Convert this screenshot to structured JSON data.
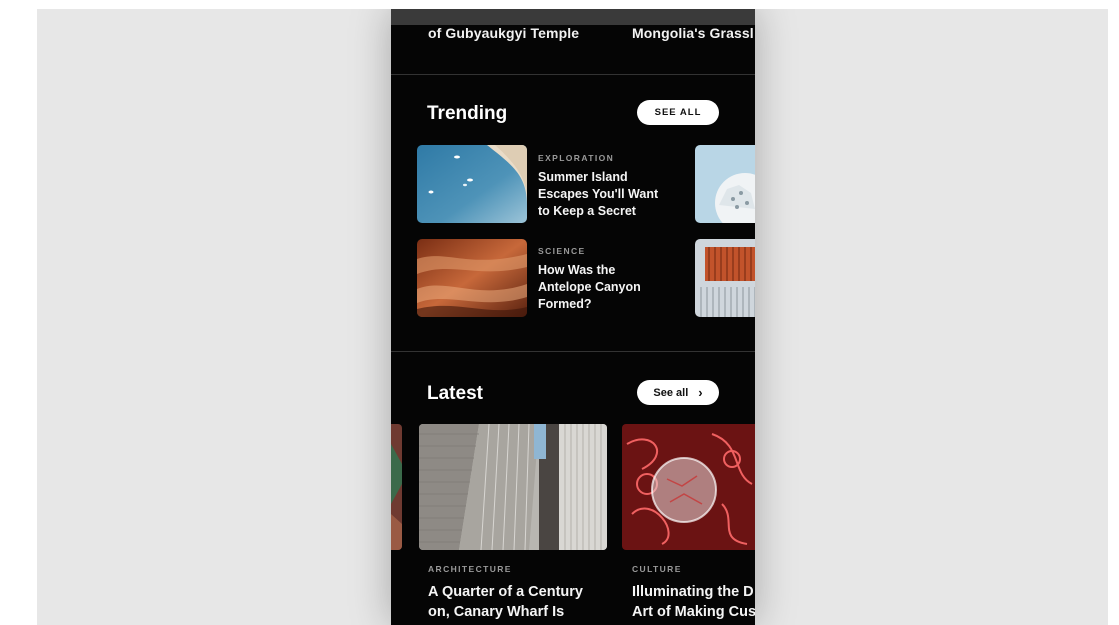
{
  "top_row": {
    "left_title": "of Gubyaukgyi Temple",
    "right_title": "Mongolia's Grassl"
  },
  "trending": {
    "title": "Trending",
    "see_all_label": "SEE ALL",
    "items": [
      {
        "category": "EXPLORATION",
        "headline_lines": [
          "Summer Island",
          "Escapes You'll Want",
          "to Keep a Secret"
        ],
        "image_icon": "aerial-sea-image"
      },
      {
        "category": "SCIENCE",
        "headline_lines": [
          "How Was the",
          "Antelope Canyon",
          "Formed?"
        ],
        "image_icon": "canyon-image"
      }
    ]
  },
  "latest": {
    "title": "Latest",
    "see_all_label": "See all",
    "chevron_icon": "chevron-right-icon",
    "cards": [
      {
        "category": "ARCHITECTURE",
        "headline_lines": [
          "A Quarter of a Century",
          "on, Canary Wharf Is"
        ],
        "image_icon": "skyscraper-image"
      },
      {
        "category": "CULTURE",
        "headline_lines": [
          "Illuminating the D",
          "Art of Making Cus"
        ],
        "image_icon": "neon-art-image"
      }
    ]
  },
  "colors": {
    "background": "#e7e7e7",
    "app_background": "#050505",
    "text_primary": "#f5f5f5",
    "text_secondary": "#9a9a9a",
    "pill": "#ffffff"
  }
}
